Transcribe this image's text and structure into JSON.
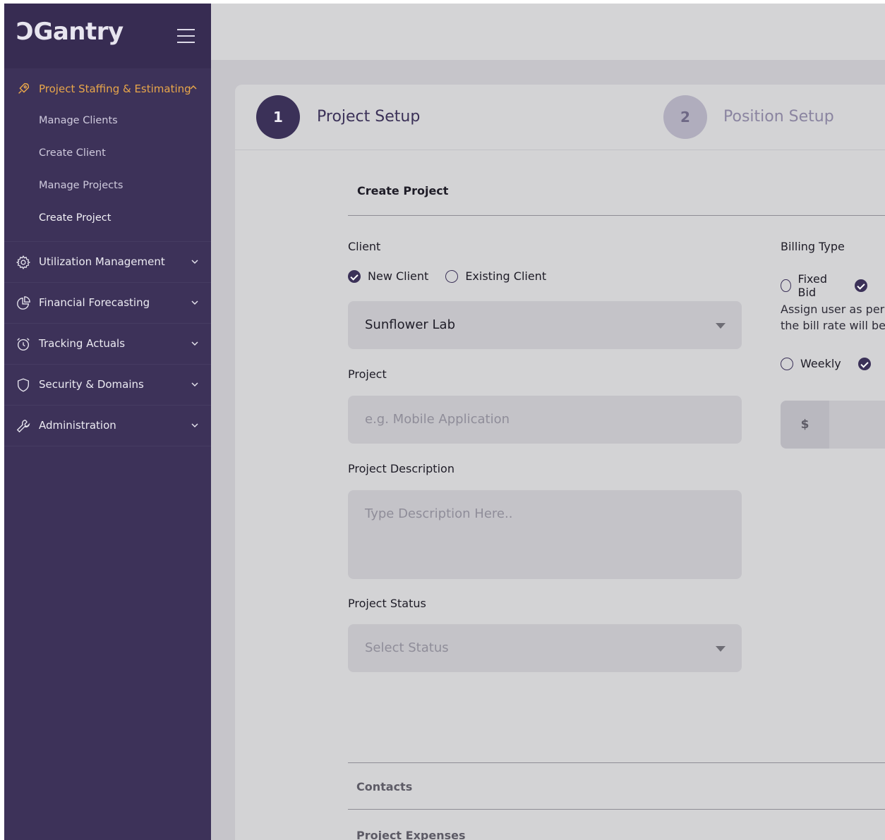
{
  "app": {
    "logo_text": "Gantry"
  },
  "sidebar": {
    "open_section": {
      "label": "Project Staffing & Estimating",
      "icon": "rocket-icon",
      "items": [
        {
          "label": "Manage Clients"
        },
        {
          "label": "Create Client"
        },
        {
          "label": "Manage Projects"
        },
        {
          "label": "Create Project"
        }
      ]
    },
    "sections": [
      {
        "label": "Utilization Management",
        "icon": "gear-icon"
      },
      {
        "label": "Financial Forecasting",
        "icon": "pie-chart-icon"
      },
      {
        "label": "Tracking Actuals",
        "icon": "alarm-clock-icon"
      },
      {
        "label": "Security & Domains",
        "icon": "shield-icon"
      },
      {
        "label": "Administration",
        "icon": "wrench-icon"
      }
    ]
  },
  "stepper": {
    "steps": [
      {
        "number": "1",
        "label": "Project Setup"
      },
      {
        "number": "2",
        "label": "Position Setup"
      }
    ]
  },
  "form": {
    "section_title": "Create Project",
    "client": {
      "label": "Client",
      "options": [
        "New Client",
        "Existing Client"
      ],
      "selected_value": "Sunflower Lab"
    },
    "project": {
      "label": "Project",
      "placeholder": "e.g. Mobile Application"
    },
    "description": {
      "label": "Project Description",
      "placeholder": "Type Description Here.."
    },
    "status": {
      "label": "Project Status",
      "placeholder": "Select Status"
    },
    "billing": {
      "label": "Billing Type",
      "options": [
        "Fixed Bid"
      ],
      "info_line1": "Assign user as per",
      "info_line2": "the bill rate will be",
      "period_option": "Weekly",
      "currency_symbol": "$"
    }
  },
  "accordions": [
    {
      "label": "Contacts"
    },
    {
      "label": "Project Expenses"
    }
  ],
  "colors": {
    "sidebar": "#3d3259",
    "accent": "#e8a64a",
    "primary": "#3b3158"
  }
}
